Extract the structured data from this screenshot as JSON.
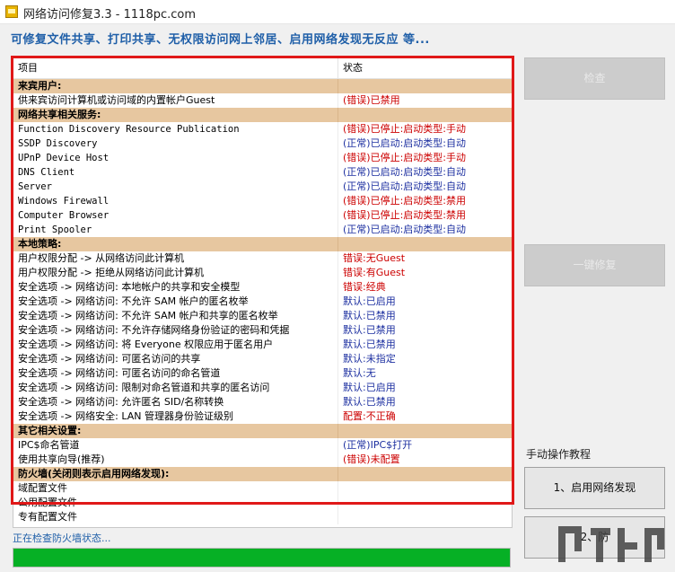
{
  "window": {
    "title": "网络访问修复3.3 - 1118pc.com"
  },
  "subtitle": "可修复文件共享、打印共享、无权限访问网上邻居、启用网络发现无反应  等...",
  "columns": {
    "item": "项目",
    "status": "状态"
  },
  "rows": [
    {
      "type": "cat",
      "item": "来宾用户:",
      "status": ""
    },
    {
      "type": "row",
      "item": "供来宾访问计算机或访问域的内置帐户Guest",
      "status": "(错误)已禁用",
      "color": "red"
    },
    {
      "type": "cat",
      "item": "网络共享相关服务:",
      "status": ""
    },
    {
      "type": "row",
      "item": "Function Discovery Resource Publication",
      "status": "(错误)已停止:启动类型:手动",
      "color": "red",
      "mono": true
    },
    {
      "type": "row",
      "item": "SSDP Discovery",
      "status": "(正常)已启动:启动类型:自动",
      "color": "blue",
      "mono": true
    },
    {
      "type": "row",
      "item": "UPnP Device Host",
      "status": "(错误)已停止:启动类型:手动",
      "color": "red",
      "mono": true
    },
    {
      "type": "row",
      "item": "DNS Client",
      "status": "(正常)已启动:启动类型:自动",
      "color": "blue",
      "mono": true
    },
    {
      "type": "row",
      "item": "Server",
      "status": "(正常)已启动:启动类型:自动",
      "color": "blue",
      "mono": true
    },
    {
      "type": "row",
      "item": "Windows Firewall",
      "status": "(错误)已停止:启动类型:禁用",
      "color": "red",
      "mono": true
    },
    {
      "type": "row",
      "item": "Computer Browser",
      "status": "(错误)已停止:启动类型:禁用",
      "color": "red",
      "mono": true
    },
    {
      "type": "row",
      "item": "Print Spooler",
      "status": "(正常)已启动:启动类型:自动",
      "color": "blue",
      "mono": true
    },
    {
      "type": "cat",
      "item": "本地策略:",
      "status": ""
    },
    {
      "type": "row",
      "item": "用户权限分配 -> 从网络访问此计算机",
      "status": "错误:无Guest",
      "color": "red"
    },
    {
      "type": "row",
      "item": "用户权限分配 -> 拒绝从网络访问此计算机",
      "status": "错误:有Guest",
      "color": "red"
    },
    {
      "type": "row",
      "item": "安全选项 -> 网络访问: 本地帐户的共享和安全模型",
      "status": "错误:经典",
      "color": "red"
    },
    {
      "type": "row",
      "item": "安全选项 -> 网络访问: 不允许 SAM 帐户的匿名枚举",
      "status": "默认:已启用",
      "color": "blue"
    },
    {
      "type": "row",
      "item": "安全选项 -> 网络访问: 不允许 SAM 帐户和共享的匿名枚举",
      "status": "默认:已禁用",
      "color": "blue"
    },
    {
      "type": "row",
      "item": "安全选项 -> 网络访问: 不允许存储网络身份验证的密码和凭据",
      "status": "默认:已禁用",
      "color": "blue"
    },
    {
      "type": "row",
      "item": "安全选项 -> 网络访问: 将 Everyone 权限应用于匿名用户",
      "status": "默认:已禁用",
      "color": "blue"
    },
    {
      "type": "row",
      "item": "安全选项 -> 网络访问: 可匿名访问的共享",
      "status": "默认:未指定",
      "color": "blue"
    },
    {
      "type": "row",
      "item": "安全选项 -> 网络访问: 可匿名访问的命名管道",
      "status": "默认:无",
      "color": "blue"
    },
    {
      "type": "row",
      "item": "安全选项 -> 网络访问: 限制对命名管道和共享的匿名访问",
      "status": "默认:已启用",
      "color": "blue"
    },
    {
      "type": "row",
      "item": "安全选项 -> 网络访问: 允许匿名 SID/名称转换",
      "status": "默认:已禁用",
      "color": "blue"
    },
    {
      "type": "row",
      "item": "安全选项 -> 网络安全: LAN 管理器身份验证级别",
      "status": "配置:不正确",
      "color": "red"
    },
    {
      "type": "cat",
      "item": "其它相关设置:",
      "status": ""
    },
    {
      "type": "row",
      "item": "IPC$命名管道",
      "status": "(正常)IPC$打开",
      "color": "blue"
    },
    {
      "type": "row",
      "item": "使用共享向导(推荐)",
      "status": "(错误)未配置",
      "color": "red"
    },
    {
      "type": "cat",
      "item": "防火墙(关闭则表示启用网络发现):",
      "status": ""
    },
    {
      "type": "row",
      "item": "域配置文件",
      "status": "",
      "color": "blue"
    },
    {
      "type": "row",
      "item": "公用配置文件",
      "status": "",
      "color": "blue"
    },
    {
      "type": "row",
      "item": "专有配置文件",
      "status": "",
      "color": "blue"
    }
  ],
  "buttons": {
    "check": "检查",
    "repair": "一键修复",
    "manual_label": "手动操作教程",
    "enable_discovery": "1、启用网络发现",
    "firewall": "2、防"
  },
  "status_text": "正在检查防火墙状态...",
  "progress": 1.0,
  "watermark": "下载吧",
  "colors": {
    "category_bg": "#e7c7a0",
    "error": "#cc0000",
    "ok": "#1c2fa0",
    "highlight_border": "#e01818",
    "progress": "#06b025"
  }
}
